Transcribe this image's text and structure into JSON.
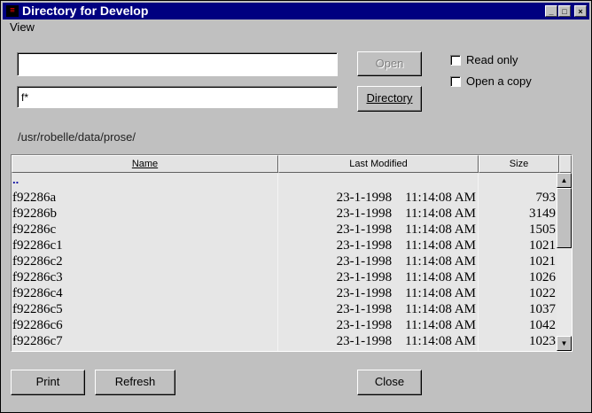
{
  "window": {
    "title": "Directory for Develop",
    "min_glyph": "_",
    "max_glyph": "□",
    "close_glyph": "×"
  },
  "menu": {
    "view": "View"
  },
  "inputs": {
    "filename_value": "",
    "filter_value": "f*"
  },
  "buttons": {
    "open": "Open",
    "directory": "Directory",
    "print": "Print",
    "refresh": "Refresh",
    "close": "Close"
  },
  "options": {
    "read_only": "Read only",
    "open_copy": "Open a copy"
  },
  "current_path": "/usr/robelle/data/prose/",
  "list": {
    "headers": {
      "name": "Name",
      "modified": "Last Modified",
      "size": "Size"
    },
    "rows": [
      {
        "name": "..",
        "modified": "",
        "size": ""
      },
      {
        "name": "f92286a",
        "modified": "23-1-1998    11:14:08 AM",
        "size": "793"
      },
      {
        "name": "f92286b",
        "modified": "23-1-1998    11:14:08 AM",
        "size": "3149"
      },
      {
        "name": "f92286c",
        "modified": "23-1-1998    11:14:08 AM",
        "size": "1505"
      },
      {
        "name": "f92286c1",
        "modified": "23-1-1998    11:14:08 AM",
        "size": "1021"
      },
      {
        "name": "f92286c2",
        "modified": "23-1-1998    11:14:08 AM",
        "size": "1021"
      },
      {
        "name": "f92286c3",
        "modified": "23-1-1998    11:14:08 AM",
        "size": "1026"
      },
      {
        "name": "f92286c4",
        "modified": "23-1-1998    11:14:08 AM",
        "size": "1022"
      },
      {
        "name": "f92286c5",
        "modified": "23-1-1998    11:14:08 AM",
        "size": "1037"
      },
      {
        "name": "f92286c6",
        "modified": "23-1-1998    11:14:08 AM",
        "size": "1042"
      },
      {
        "name": "f92286c7",
        "modified": "23-1-1998    11:14:08 AM",
        "size": "1023"
      }
    ]
  },
  "scrollbar": {
    "up_glyph": "▲",
    "down_glyph": "▼"
  }
}
